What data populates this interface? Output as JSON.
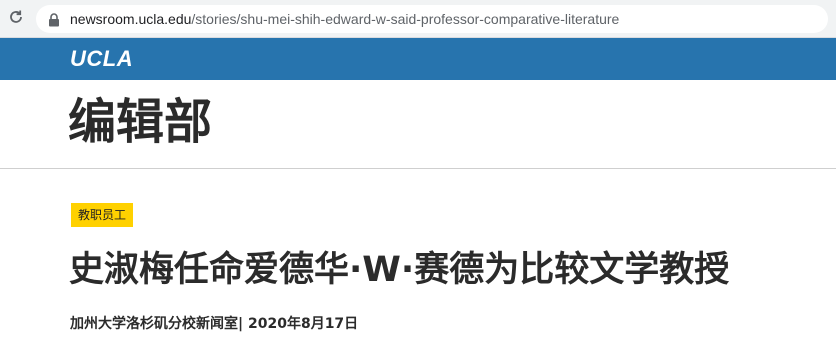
{
  "browser": {
    "url_host": "newsroom.ucla.edu",
    "url_path": "/stories/shu-mei-shih-edward-w-said-professor-comparative-literature"
  },
  "header": {
    "logo_text": "UCLA",
    "bar_color": "#2774ae"
  },
  "page": {
    "section_title": "编辑部"
  },
  "article": {
    "category_badge": "教职员工",
    "badge_color": "#ffd100",
    "headline": "史淑梅任命爱德华·W·赛德为比较文学教授",
    "byline": "加州大学洛杉矶分校新闻室| 2020年8月17日"
  }
}
